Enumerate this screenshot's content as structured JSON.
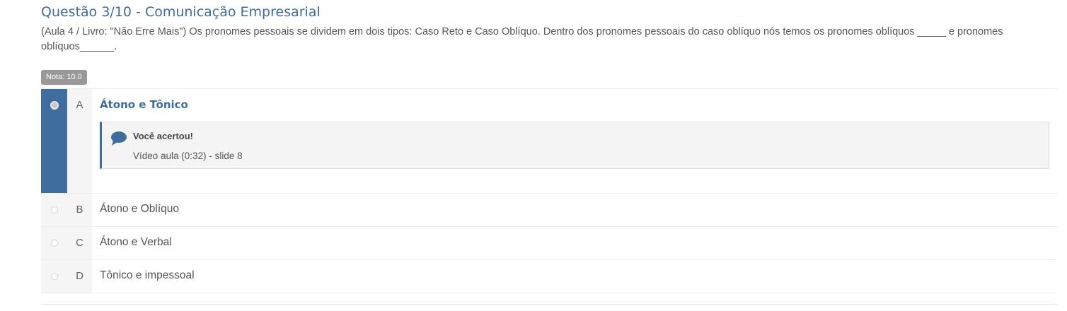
{
  "question": {
    "title": "Questão 3/10 - Comunicação Empresarial",
    "text": "(Aula 4 / Livro: \"Não Erre Mais\") Os pronomes pessoais se dividem em dois tipos: Caso Reto e Caso Oblíquo. Dentro dos pronomes pessoais do caso oblíquo nós temos os pronomes oblíquos _____ e pronomes oblíquos______.",
    "grade_badge": "Nota: 10.0"
  },
  "options": [
    {
      "letter": "A",
      "label": "Átono e Tônico",
      "selected": true,
      "feedback": {
        "icon": "speech-bubble-icon",
        "title": "Você acertou!",
        "text": "Vídeo aula (0:32) - slide 8"
      }
    },
    {
      "letter": "B",
      "label": "Átono e Oblíquo",
      "selected": false
    },
    {
      "letter": "C",
      "label": "Átono e Verbal",
      "selected": false
    },
    {
      "letter": "D",
      "label": "Tônico e impessoal",
      "selected": false
    }
  ],
  "colors": {
    "accent": "#3f6d9e",
    "badge": "#999999",
    "text": "#555555"
  }
}
